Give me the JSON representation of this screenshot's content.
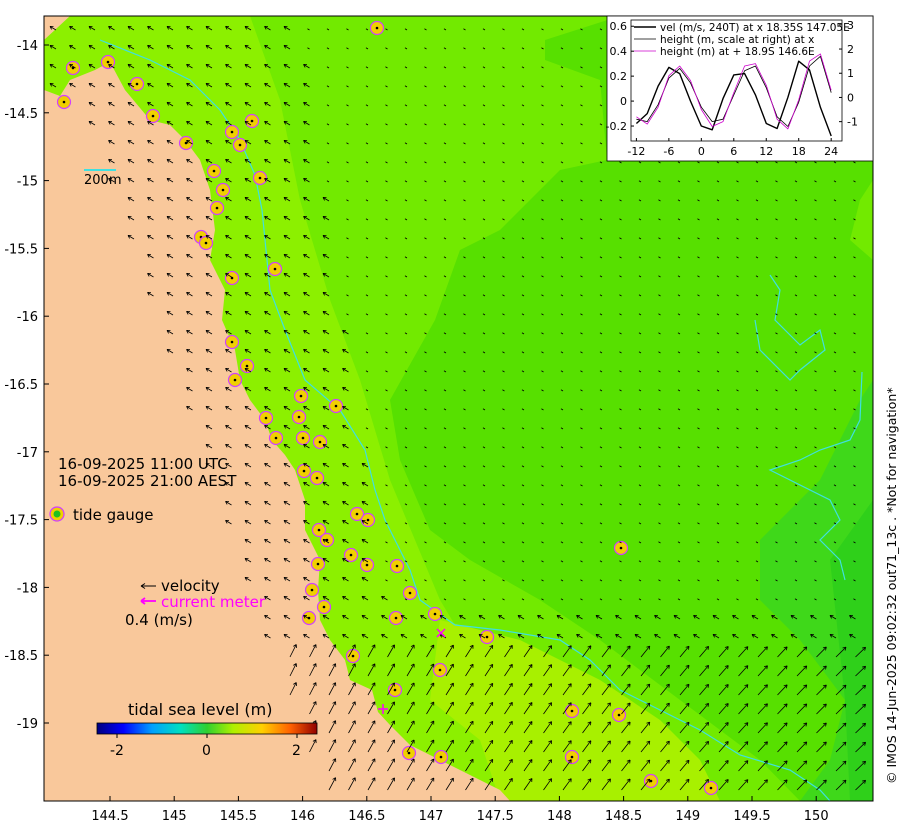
{
  "colors": {
    "land": "#f9c89b",
    "sea_high": "#8cf000",
    "sea_mid": "#57e000",
    "sea_low": "#33d21a",
    "isobath": "#3fe0e0",
    "gauge_ring": "#d040ff",
    "gauge_fill": "#f0d000",
    "current_meter": "#ff00ff"
  },
  "map": {
    "lon_ticks": [
      "144.5",
      "145",
      "145.5",
      "146",
      "146.5",
      "147",
      "147.5",
      "148",
      "148.5",
      "149",
      "149.5",
      "150"
    ],
    "lat_ticks": [
      "-14",
      "-14.5",
      "-15",
      "-15.5",
      "-16",
      "-16.5",
      "-17",
      "-17.5",
      "-18",
      "-18.5",
      "-19"
    ],
    "isobath_label": "200m",
    "time_utc": "16-09-2025 11:00 UTC",
    "time_aest": "16-09-2025 21:00 AEST",
    "tide_gauge_label": "tide gauge",
    "velocity_label": "velocity",
    "current_meter_label": "current meter",
    "scale_label": "0.4 (m/s)",
    "colorbar_title": "tidal sea level (m)",
    "colorbar_ticks": [
      "-2",
      "0",
      "2"
    ],
    "credit": "© IMOS 14-Jun-2025 09:02:32 out71_13c . *Not for navigation*"
  },
  "chart_data": {
    "type": "line",
    "x_ticks": [
      "-12",
      "-6",
      "0",
      "6",
      "12",
      "18",
      "24"
    ],
    "xlim": [
      -13,
      26
    ],
    "left_ticks": [
      "0.6",
      "0.4",
      "0.2",
      "0",
      "-0.2"
    ],
    "right_ticks": [
      "3",
      "2",
      "1",
      "0",
      "-1"
    ],
    "series": [
      {
        "name": "vel (m/s, 240T) at x 18.35S 147.05E",
        "color": "#000000",
        "width": 1.4,
        "x": [
          -12,
          -10,
          -8,
          -6,
          -4,
          -2,
          0,
          2,
          4,
          6,
          8,
          10,
          12,
          14,
          16,
          18,
          20,
          22,
          24
        ],
        "y": [
          -0.18,
          -0.1,
          0.12,
          0.27,
          0.22,
          0.0,
          -0.2,
          -0.23,
          0.02,
          0.21,
          0.22,
          0.05,
          -0.18,
          -0.22,
          0.03,
          0.32,
          0.25,
          -0.05,
          -0.28
        ]
      },
      {
        "name": "height (m, scale at right) at x",
        "color": "#000000",
        "width": 0.8,
        "x": [
          -12,
          -10,
          -8,
          -6,
          -4,
          -2,
          0,
          2,
          4,
          6,
          8,
          10,
          12,
          14,
          16,
          18,
          20,
          22,
          24
        ],
        "y": [
          -0.9,
          -1.0,
          -0.3,
          0.8,
          1.2,
          0.6,
          -0.4,
          -1.0,
          -0.9,
          0.1,
          1.1,
          1.3,
          0.4,
          -0.8,
          -1.2,
          -0.2,
          1.3,
          1.7,
          0.2
        ]
      },
      {
        "name": "height (m) at + 18.9S 146.6E",
        "color": "#cc00cc",
        "width": 0.8,
        "x": [
          -12,
          -10,
          -8,
          -6,
          -4,
          -2,
          0,
          2,
          4,
          6,
          8,
          10,
          12,
          14,
          16,
          18,
          20,
          22,
          24
        ],
        "y": [
          -0.8,
          -1.1,
          -0.4,
          0.9,
          1.3,
          0.7,
          -0.5,
          -1.2,
          -1.0,
          0.2,
          1.3,
          1.4,
          0.5,
          -0.9,
          -1.3,
          -0.1,
          1.5,
          1.8,
          0.3
        ]
      }
    ]
  }
}
